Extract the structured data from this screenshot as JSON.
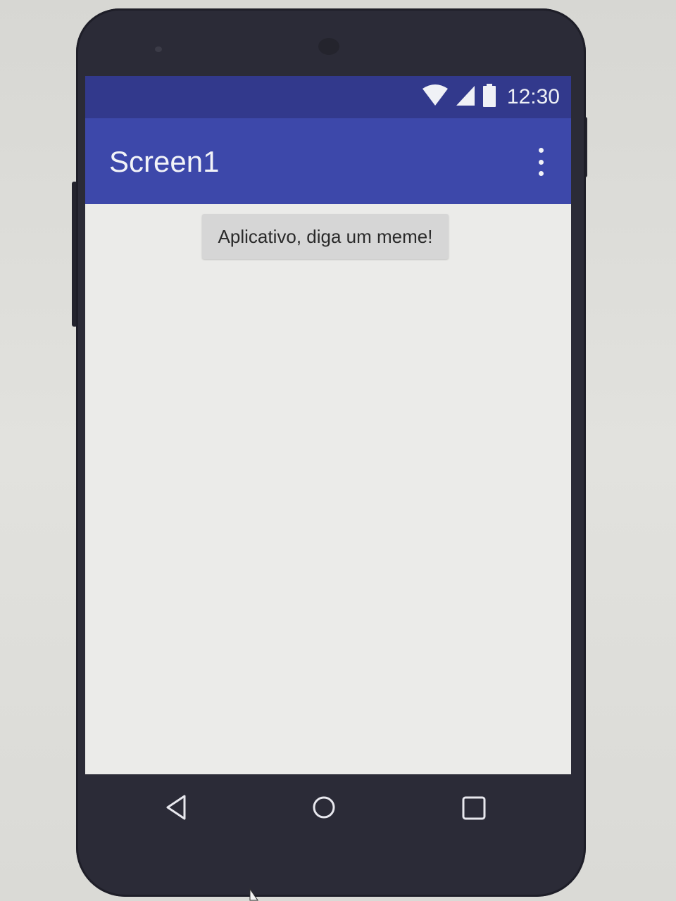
{
  "status_bar": {
    "time": "12:30",
    "icons": [
      "wifi-icon",
      "signal-icon",
      "battery-icon"
    ],
    "background_color": "#32398c"
  },
  "app_bar": {
    "title": "Screen1",
    "menu_icon": "overflow-menu-icon",
    "background_color": "#3d48aa"
  },
  "content": {
    "button_label": "Aplicativo, diga um meme!"
  },
  "nav_bar": {
    "buttons": [
      "back-icon",
      "home-icon",
      "recents-icon"
    ]
  }
}
